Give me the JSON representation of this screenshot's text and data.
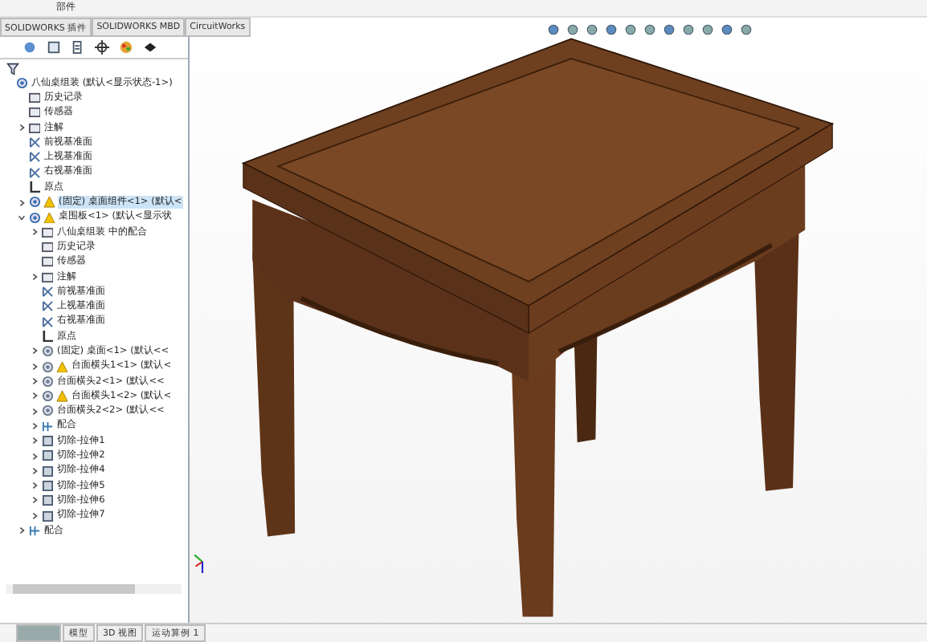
{
  "ribbon": {
    "label": "部件"
  },
  "command_tabs": [
    {
      "label": "SOLIDWORKS 插件",
      "selected": false
    },
    {
      "label": "SOLIDWORKS MBD",
      "selected": false
    },
    {
      "label": "CircuitWorks",
      "selected": false
    }
  ],
  "tree": [
    {
      "label": "八仙桌组装 (默认<显示状态-1>)",
      "kind": "assembly",
      "selected": false,
      "children": [
        {
          "label": "历史记录",
          "kind": "folder",
          "selected": false
        },
        {
          "label": "传感器",
          "kind": "sensor",
          "selected": false
        },
        {
          "label": "注解",
          "kind": "annotation",
          "selected": false,
          "expanded": false
        },
        {
          "label": "前视基准面",
          "kind": "plane",
          "selected": false
        },
        {
          "label": "上视基准面",
          "kind": "plane",
          "selected": false
        },
        {
          "label": "右视基准面",
          "kind": "plane",
          "selected": false
        },
        {
          "label": "原点",
          "kind": "origin",
          "selected": false
        },
        {
          "label": "(固定) 桌面组件<1> (默认<",
          "kind": "assembly",
          "warning": true,
          "selected": true,
          "expanded": false
        },
        {
          "label": "桌围板<1> (默认<显示状",
          "kind": "assembly",
          "warning": true,
          "selected": false,
          "expanded": true,
          "children": [
            {
              "label": "八仙桌组装 中的配合",
              "kind": "folder",
              "selected": false,
              "expanded": false
            },
            {
              "label": "历史记录",
              "kind": "folder",
              "selected": false
            },
            {
              "label": "传感器",
              "kind": "sensor",
              "selected": false
            },
            {
              "label": "注解",
              "kind": "annotation",
              "selected": false,
              "expanded": false
            },
            {
              "label": "前视基准面",
              "kind": "plane",
              "selected": false
            },
            {
              "label": "上视基准面",
              "kind": "plane",
              "selected": false
            },
            {
              "label": "右视基准面",
              "kind": "plane",
              "selected": false
            },
            {
              "label": "原点",
              "kind": "origin",
              "selected": false
            },
            {
              "label": "(固定) 桌面<1> (默认<<",
              "kind": "part",
              "selected": false,
              "expanded": false
            },
            {
              "label": "台面横头1<1> (默认<",
              "kind": "part",
              "warning": true,
              "selected": false,
              "expanded": false
            },
            {
              "label": "台面横头2<1> (默认<<",
              "kind": "part",
              "selected": false,
              "expanded": false
            },
            {
              "label": "台面横头1<2> (默认<",
              "kind": "part",
              "warning": true,
              "selected": false,
              "expanded": false
            },
            {
              "label": "台面横头2<2> (默认<<",
              "kind": "part",
              "selected": false,
              "expanded": false
            },
            {
              "label": "配合",
              "kind": "mates",
              "selected": false,
              "expanded": false
            },
            {
              "label": "切除-拉伸1",
              "kind": "feature",
              "selected": false,
              "expanded": false
            },
            {
              "label": "切除-拉伸2",
              "kind": "feature",
              "selected": false,
              "expanded": false
            },
            {
              "label": "切除-拉伸4",
              "kind": "feature",
              "selected": false,
              "expanded": false
            },
            {
              "label": "切除-拉伸5",
              "kind": "feature",
              "selected": false,
              "expanded": false
            },
            {
              "label": "切除-拉伸6",
              "kind": "feature",
              "selected": false,
              "expanded": false
            },
            {
              "label": "切除-拉伸7",
              "kind": "feature",
              "selected": false,
              "expanded": false
            }
          ]
        },
        {
          "label": "配合",
          "kind": "mates",
          "selected": false,
          "expanded": false
        }
      ]
    }
  ],
  "bottom_tabs": [
    {
      "selected": true
    },
    {
      "label": "模型",
      "selected": false
    },
    {
      "label": "3D 视图",
      "selected": false
    },
    {
      "label": "运动算例 1",
      "selected": false
    }
  ]
}
